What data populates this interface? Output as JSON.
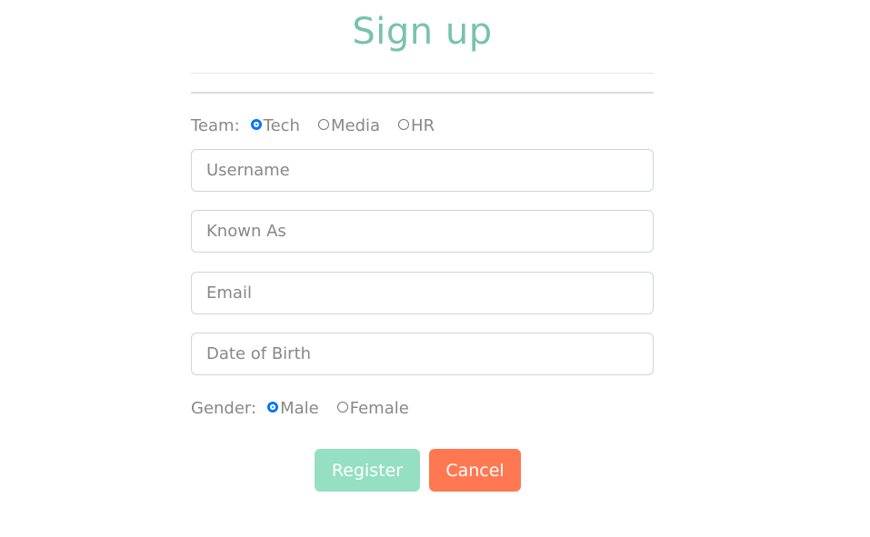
{
  "page": {
    "title": "Sign up"
  },
  "team": {
    "label": "Team:",
    "options": [
      {
        "label": "Tech",
        "checked": true
      },
      {
        "label": "Media",
        "checked": false
      },
      {
        "label": "HR",
        "checked": false
      }
    ]
  },
  "fields": {
    "username": {
      "placeholder": "Username",
      "value": ""
    },
    "known_as": {
      "placeholder": "Known As",
      "value": ""
    },
    "email": {
      "placeholder": "Email",
      "value": ""
    },
    "dob": {
      "placeholder": "Date of Birth",
      "value": ""
    }
  },
  "gender": {
    "label": "Gender:",
    "options": [
      {
        "label": "Male",
        "checked": true
      },
      {
        "label": "Female",
        "checked": false
      }
    ]
  },
  "buttons": {
    "register": "Register",
    "cancel": "Cancel"
  },
  "colors": {
    "title": "#78c2ad",
    "register_bg": "#95dfc2",
    "cancel_bg": "#ff7851",
    "radio_checked": "#0075ff"
  }
}
